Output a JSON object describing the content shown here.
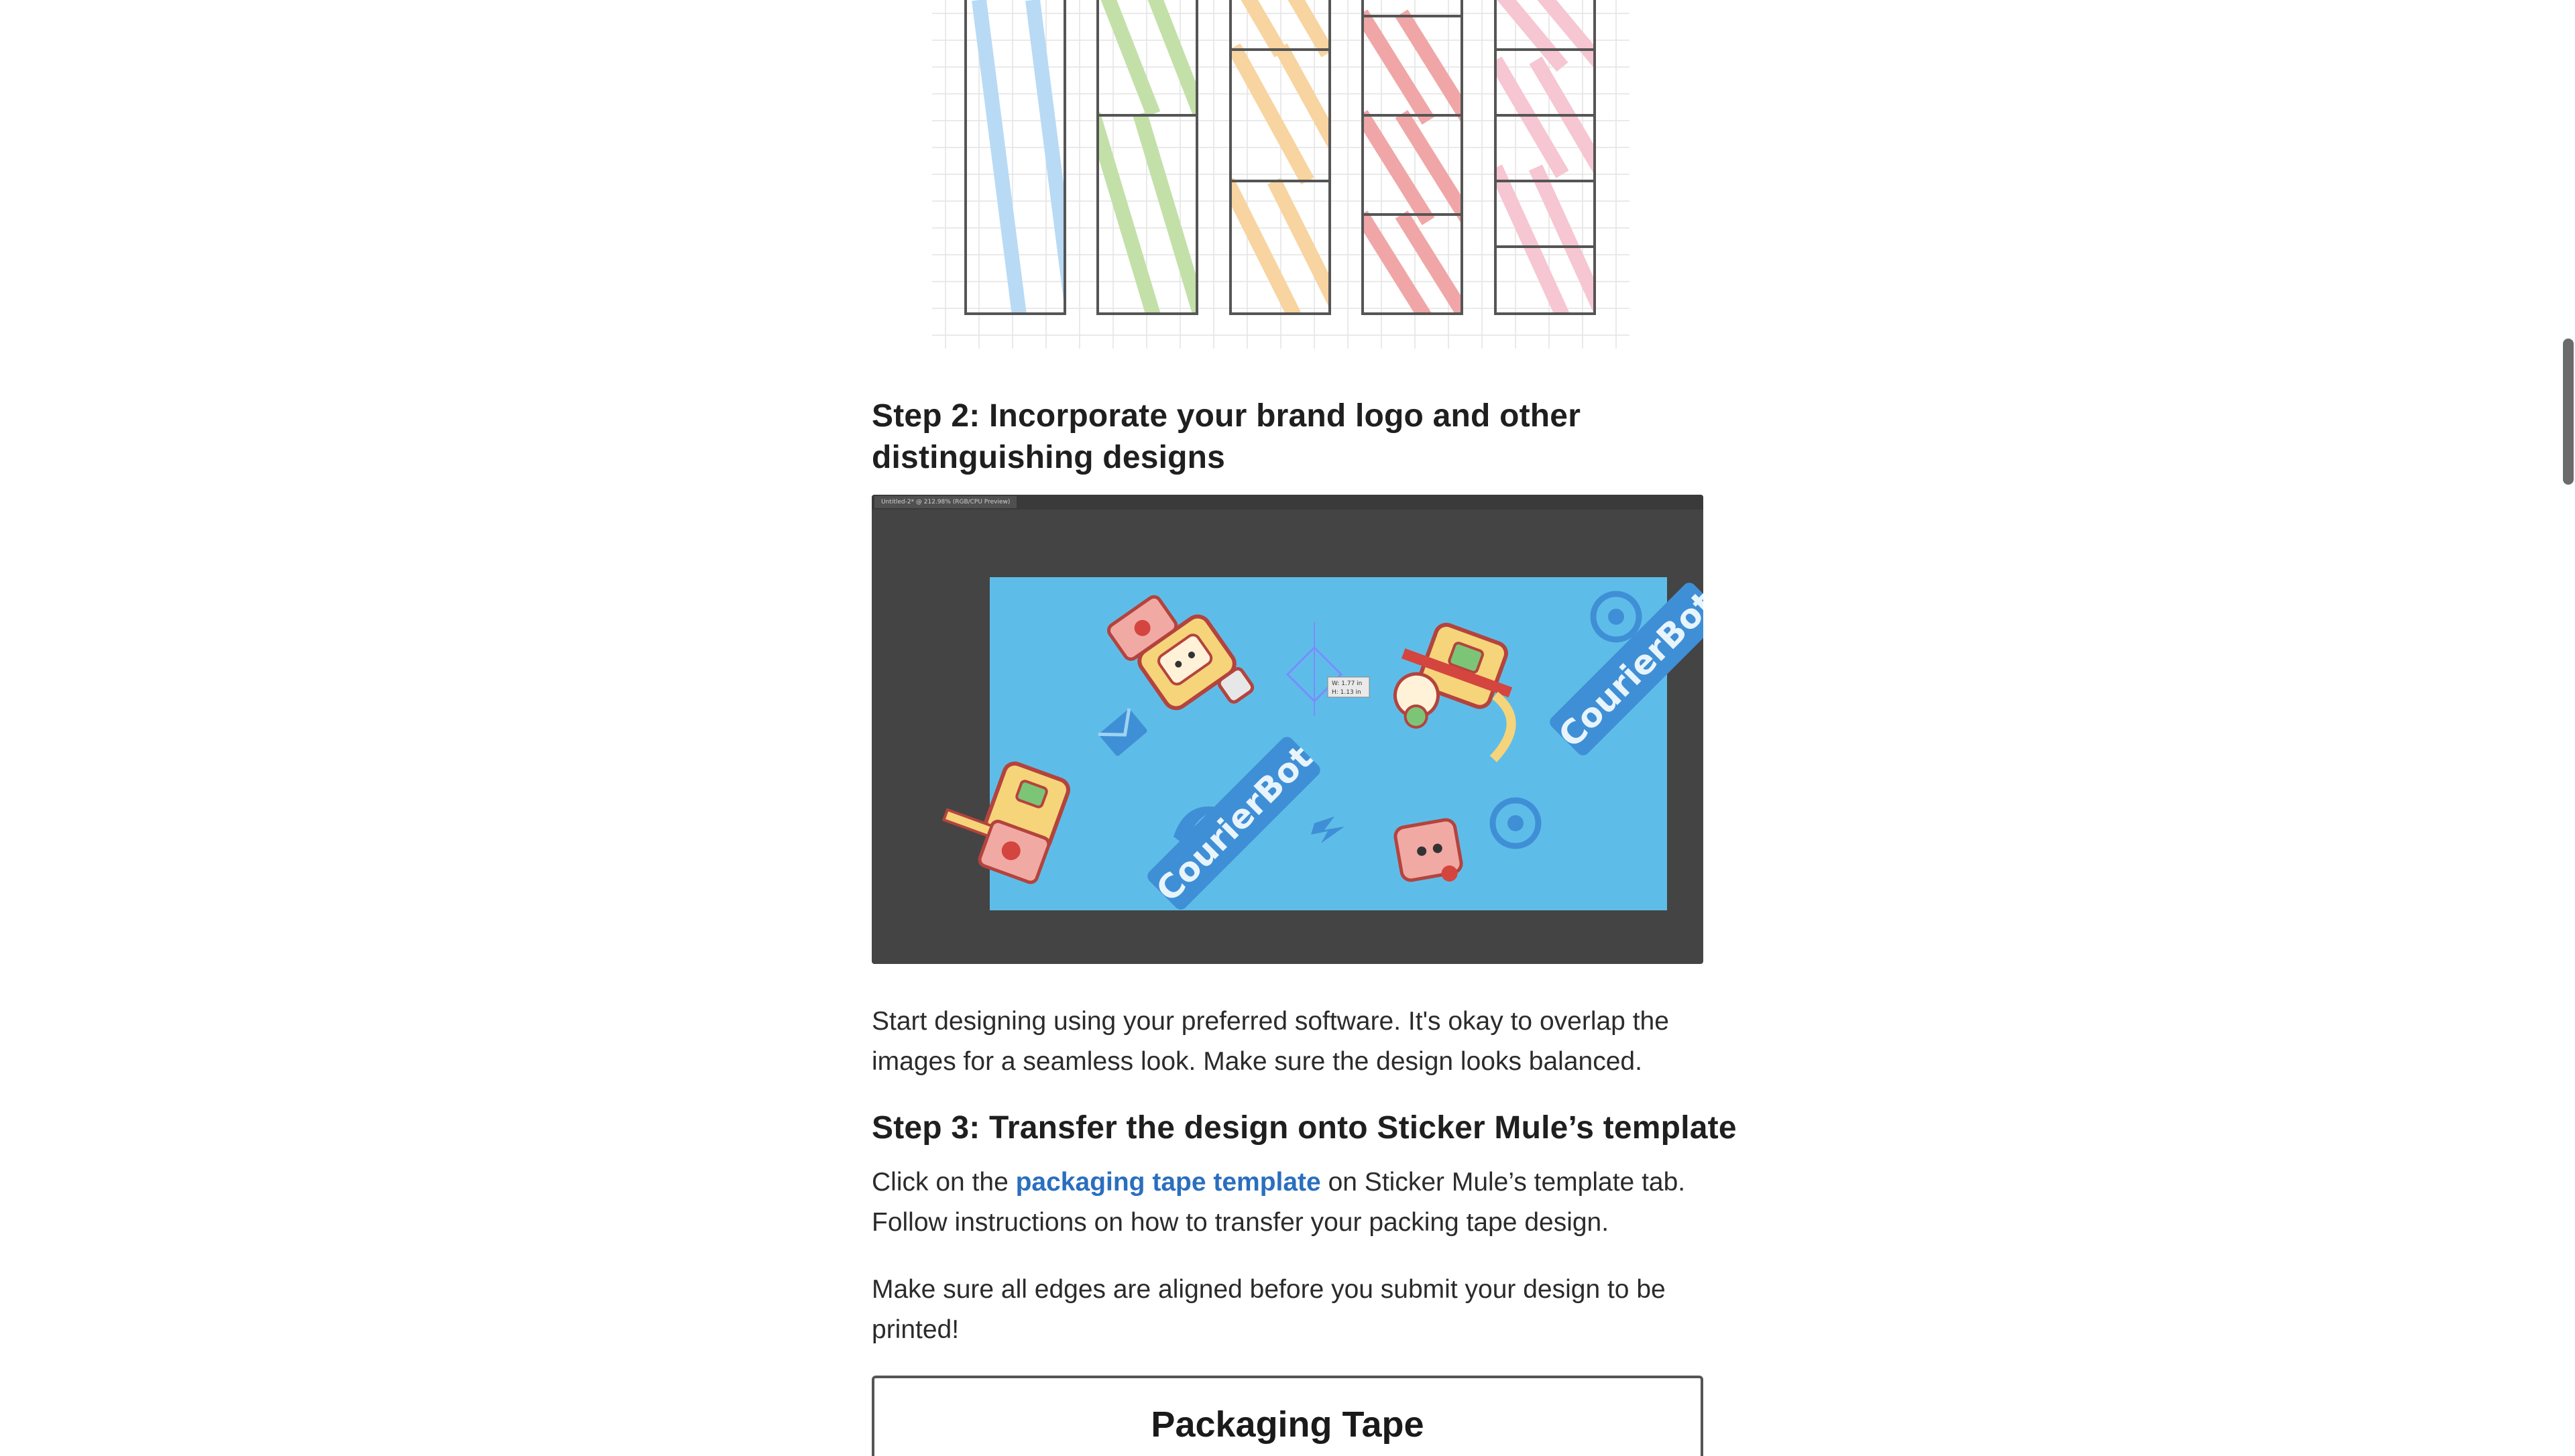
{
  "step2": {
    "heading_line1": "Step 2: Incorporate your brand logo and other",
    "heading_line2": "distinguishing designs"
  },
  "editor_image": {
    "tab_label": "Untitled-2* @ 212.98% (RGB/CPU Preview)",
    "logo_text": "CourierBot",
    "transform_readout_1": "W: 1.77 in",
    "transform_readout_2": "H: 1.13 in"
  },
  "paragraph1": {
    "line1": "Start designing using your preferred software. It's okay to overlap the",
    "line2": "images for a seamless look. Make sure the design looks balanced."
  },
  "step3": {
    "heading": "Step 3: Transfer the design onto Sticker Mule’s template"
  },
  "paragraph2": {
    "prefix": "Click on the ",
    "link_text": "packaging tape template",
    "suffix": " on Sticker Mule’s template tab.",
    "line2": "Follow instructions on how to transfer your packing tape design."
  },
  "paragraph3": {
    "line1": "Make sure all edges are aligned before you submit your design to be",
    "line2": "printed!"
  },
  "bottom_card": {
    "title": "Packaging Tape"
  },
  "colors": {
    "link": "#2a6fbf",
    "canvas_blue": "#5ebde8",
    "editor_bg": "#444444",
    "stripe_blue": "#b8daf5",
    "stripe_green": "#c3e0a8",
    "stripe_orange": "#f7d4a0",
    "stripe_red": "#f0a6a6",
    "stripe_pink": "#f6c6d2"
  }
}
